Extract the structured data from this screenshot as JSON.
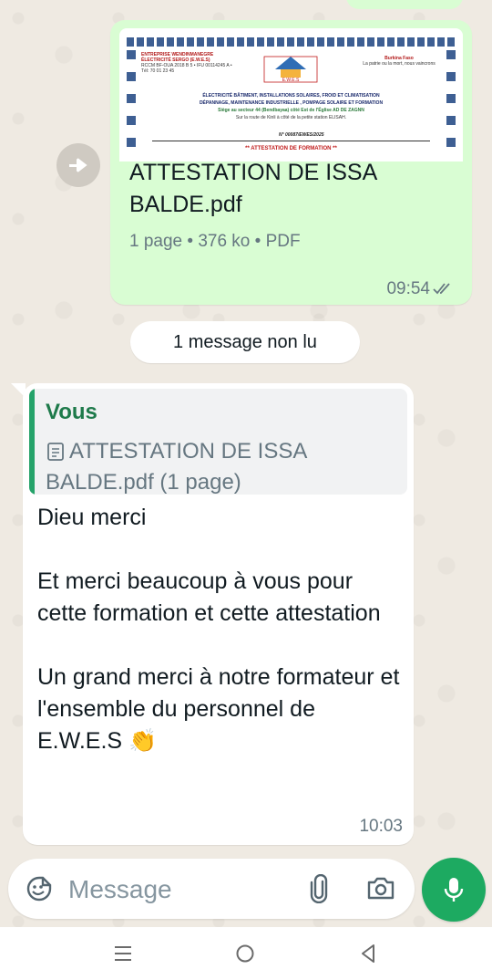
{
  "document_message": {
    "file_name": "ATTESTATION DE ISSA BALDE.pdf",
    "meta": "1 page • 376 ko • PDF",
    "time": "09:54",
    "status_icon": "double-check-icon",
    "preview": {
      "org_name": "ENTREPRISE WENDINMANEGRE ÉLECTRICITÉ SERGO (E.W.E.S)",
      "org_details": "RCCM BF-OUA 2018 B 5 • IFU 00114245 A • Tél: 70 01 23 45",
      "logo_text": "E.W.E.S",
      "country": "Burkina Faso",
      "motto": "La patrie ou la mort, nous vaincrons",
      "services_line1": "ÉLECTRICITÉ BÂTIMENT, INSTALLATIONS SOLAIRES, FROID ET CLIMATISATION",
      "services_line2": "DÉPANNAGE, MAINTENANCE INDUSTRIELLE , POMPAGE SOLAIRE ET FORMATION",
      "address_line1": "Siège au secteur 44 (Bendbayaa) côté Est de l'Église AD DE ZAGNN",
      "address_line2": "Sur la route de Kinli à côté de la petite station ELISAH.",
      "reference": "N° 00087/EWES/2025",
      "doc_title": "** ATTESTATION DE FORMATION **"
    }
  },
  "unread_banner": "1 message non lu",
  "reply_message": {
    "quoted": {
      "author": "Vous",
      "icon": "document-icon",
      "text": "ATTESTATION DE ISSA BALDE.pdf (1 page)"
    },
    "text": "Dieu merci\n\nEt merci beaucoup à vous pour cette formation et cette attestation\n\nUn grand merci à notre formateur et l'ensemble du personnel de E.W.E.S",
    "emoji": "👏",
    "time": "10:03"
  },
  "composer": {
    "placeholder": "Message",
    "icons": [
      "emoji-icon",
      "attach-icon",
      "camera-icon",
      "mic-icon"
    ]
  },
  "colors": {
    "outgoing_bubble": "#d9fdd3",
    "incoming_bubble": "#ffffff",
    "quote_accent": "#25a36a",
    "mic_button": "#1daa61",
    "wallpaper": "#efeae2"
  },
  "navbar": {
    "icons": [
      "recents-icon",
      "home-icon",
      "back-icon"
    ]
  }
}
